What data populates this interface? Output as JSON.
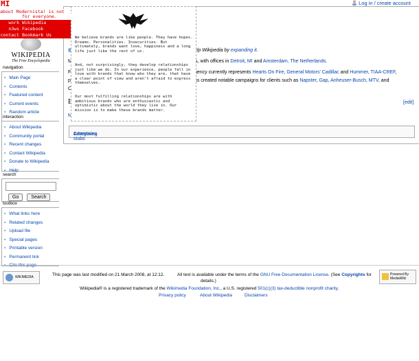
{
  "personal_tools": {
    "login": "Log in / create account"
  },
  "logo": {
    "wordmark": "WIKIPEDIA",
    "tagline": "The Free Encyclopedia"
  },
  "navigation": {
    "title": "navigation",
    "items": [
      "Main Page",
      "Contents",
      "Featured content",
      "Current events",
      "Random article"
    ]
  },
  "interaction": {
    "title": "interaction",
    "items": [
      "About Wikipedia",
      "Community portal",
      "Recent changes",
      "Contact Wikipedia",
      "Donate to Wikipedia",
      "Help"
    ]
  },
  "search": {
    "title": "search",
    "go": "Go",
    "search": "Search"
  },
  "toolbox": {
    "title": "toolbox",
    "items": [
      "What links here",
      "Related changes",
      "Upload file",
      "Special pages",
      "Printable version",
      "Permanent link",
      "Cite this page"
    ]
  },
  "content": {
    "stub_suffix": "elp Wikipedia by",
    "stub_link": "expanding it",
    "line1_pre": "A",
    "line1_mid": ", with offices in",
    "detroit": "Detroit",
    "mi": "MI",
    "and": "and",
    "amsterdam": "Amsterdam, The Netherlands.",
    "line2_pre": "gency currently represents",
    "client_a": "Hearts On Fire",
    "client_b": "General Motors' Cadillac",
    "client_c": "Hummer",
    "client_d": "TIAA-CREF",
    "line3_pre": "as created notable campaigns for clients such as",
    "c1": "Napster",
    "c2": "Gap",
    "c3": "Anheuser-Busch",
    "c4": "MTV",
    "c5": "and",
    "edit": "[edit]",
    "cat_label": "Categories",
    "cat_value": "Advertising stubs",
    "left_frag_f": "F",
    "left_frag_p": "p",
    "left_frag_c": "C",
    "left_frag_m": "M",
    "left_frag_e": "E",
    "left_frag_m2": "M"
  },
  "overlay": {
    "p1": "We believe brands are like people. They have hopes. Dreams. Personalities. Insecurities. But ultimately, brands want love, happiness and a long life just like the rest of us.",
    "p2": "And, not surprisingly, they develop relationships just like we do. In our experience, people fall in love with brands that know who they are, that have a clear point of view and aren't afraid to express themselves.",
    "p3": "Our most fulfilling relationships are with ambitious brands who are enthusiastic and optimistic about the world they live in. Our mission is to make these brands matter."
  },
  "redmenu": {
    "logo": "MI",
    "about": "about Modernista! is not",
    "for": "for everyone.",
    "work": "work",
    "news": "n3ws",
    "contact": "contact",
    "items": [
      "Wikipedia",
      "Facebook",
      "Bookmark Us"
    ]
  },
  "footer": {
    "wm_badge": "WIKIMEDIA",
    "mw_badge": "Powered By MediaWiki",
    "modified": "This page was last modified on 21 March 2008, at 12:12.",
    "license_pre": "All text is available under the terms of the",
    "license_link": "GNU Free Documentation License",
    "license_post": ". (See",
    "copyrights": "Copyrights",
    "license_end": "for",
    "details": "details.)",
    "trademark_pre": "Wikipedia® is a registered trademark of the",
    "foundation": "Wikimedia Foundation, Inc.",
    "trademark_mid": ", a U.S. registered",
    "taxlink": "501(c)(3) tax-deductible nonprofit charity",
    "period": ".",
    "links": [
      "Privacy policy",
      "About Wikipedia",
      "Disclaimers"
    ]
  }
}
